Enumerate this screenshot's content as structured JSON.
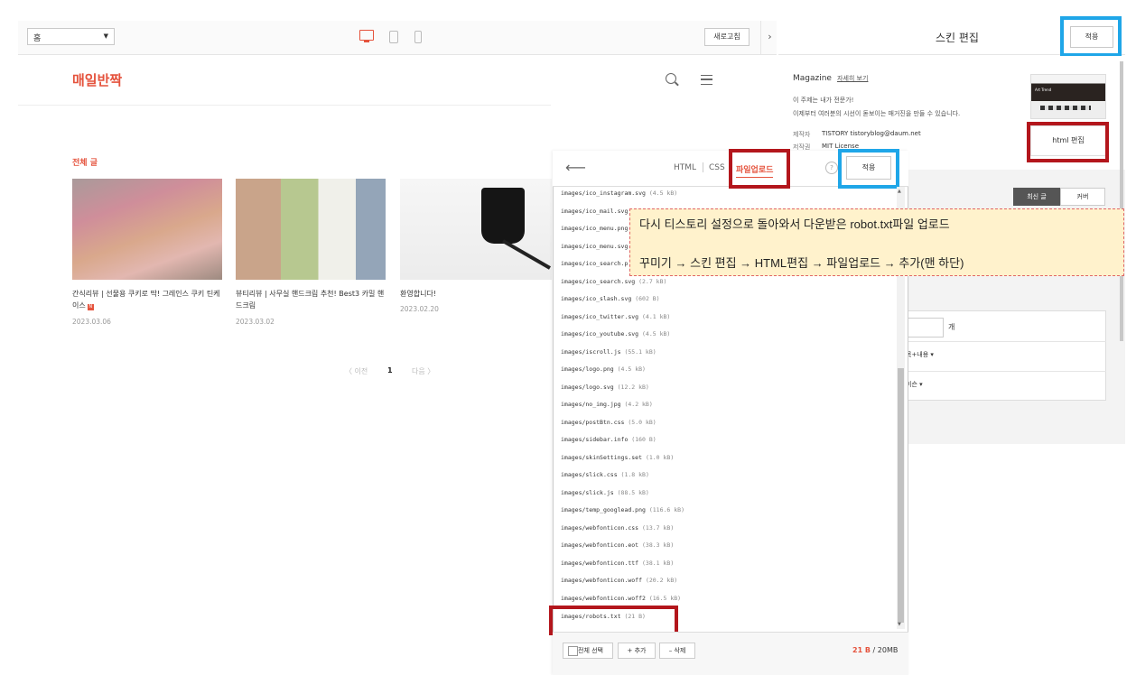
{
  "preview": {
    "page_select": "홈",
    "refresh_label": "새로고침",
    "collapse_icon": "›"
  },
  "blog": {
    "logo": "매일반짝",
    "category_title": "전체 글",
    "posts": [
      {
        "title": "간식리뷰 | 선물용 쿠키로 딱! 그레인스 쿠키 틴케이스",
        "badge": "N",
        "date": "2023.03.06"
      },
      {
        "title": "뷰티리뷰 | 사무실 핸드크림 추천! Best3 카밀 핸드크림",
        "date": "2023.03.02"
      },
      {
        "title": "환영합니다!",
        "date": "2023.02.20"
      }
    ],
    "pagination": {
      "prev": "〈 이전",
      "current": "1",
      "next": "다음 〉"
    }
  },
  "skin_panel": {
    "title": "스킨 편집",
    "apply_label": "적용",
    "skin_name": "Magazine",
    "detail_link": "자세히 보기",
    "desc1": "이 주제는 내가 전문가!",
    "desc2": "이제부터 여러분의 시선이 돋보이는 매거진을 만들 수 있습니다.",
    "maker_label": "제작자",
    "maker_value": "TISTORY tistoryblog@daum.net",
    "license_label": "저작권",
    "license_value": "MIT License",
    "thumb_text": "Art Trend",
    "html_edit_label": "html 편집",
    "tabs": [
      "최신 글",
      "커버"
    ],
    "count_unit": "개",
    "option1": "목+내용 ▾",
    "option2": "이슨 ▾"
  },
  "editor": {
    "tabs": {
      "html": "HTML",
      "css": "CSS",
      "upload": "파일업로드"
    },
    "help": "?",
    "apply_label": "적용",
    "files": [
      {
        "name": "images/ico_instagram.svg",
        "size": "(4.5 kB)"
      },
      {
        "name": "images/ico_mail.svg",
        "size": ""
      },
      {
        "name": "images/ico_menu.png",
        "size": ""
      },
      {
        "name": "images/ico_menu.svg",
        "size": ""
      },
      {
        "name": "images/ico_search.p",
        "size": ""
      },
      {
        "name": "images/ico_search.svg",
        "size": "(2.7 kB)"
      },
      {
        "name": "images/ico_slash.svg",
        "size": "(602 B)"
      },
      {
        "name": "images/ico_twitter.svg",
        "size": "(4.1 kB)"
      },
      {
        "name": "images/ico_youtube.svg",
        "size": "(4.5 kB)"
      },
      {
        "name": "images/iscroll.js",
        "size": "(55.1 kB)"
      },
      {
        "name": "images/logo.png",
        "size": "(4.5 kB)"
      },
      {
        "name": "images/logo.svg",
        "size": "(12.2 kB)"
      },
      {
        "name": "images/no_img.jpg",
        "size": "(4.2 kB)"
      },
      {
        "name": "images/postBtn.css",
        "size": "(5.0 kB)"
      },
      {
        "name": "images/sidebar.info",
        "size": "(160 B)"
      },
      {
        "name": "images/skinSettings.set",
        "size": "(1.0 kB)"
      },
      {
        "name": "images/slick.css",
        "size": "(1.8 kB)"
      },
      {
        "name": "images/slick.js",
        "size": "(88.5 kB)"
      },
      {
        "name": "images/temp_googlead.png",
        "size": "(116.6 kB)"
      },
      {
        "name": "images/webfonticon.css",
        "size": "(13.7 kB)"
      },
      {
        "name": "images/webfonticon.eot",
        "size": "(38.3 kB)"
      },
      {
        "name": "images/webfonticon.ttf",
        "size": "(38.1 kB)"
      },
      {
        "name": "images/webfonticon.woff",
        "size": "(20.2 kB)"
      },
      {
        "name": "images/webfonticon.woff2",
        "size": "(16.5 kB)"
      },
      {
        "name": "images/robots.txt",
        "size": "(21 B)"
      }
    ],
    "select_all": "전체 선택",
    "add_label": "+ 추가",
    "delete_label": "– 삭제",
    "usage_used": "21 B",
    "usage_total": " / 20MB"
  },
  "annotation": {
    "line1": "다시 티스토리 설정으로 돌아와서 다운받은 robot.txt파일 업로드",
    "line2": "꾸미기 → 스킨 편집 → HTML편집 → 파일업로드 → 추가(맨 하단)"
  },
  "colors": {
    "accent": "#e5533d",
    "highlight_blue": "#1fa6e8",
    "highlight_red": "#b3161c",
    "note_bg": "#fff2cc"
  }
}
